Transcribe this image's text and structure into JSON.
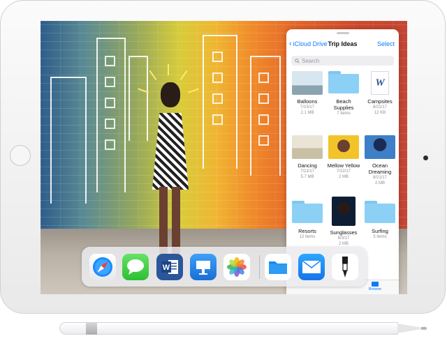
{
  "files_panel": {
    "back_label": "iCloud Drive",
    "title": "Trip Ideas",
    "select_label": "Select",
    "search_placeholder": "Search",
    "items": [
      {
        "name": "Balloons",
        "line2": "7/15/17",
        "line3": "2.1 MB",
        "kind": "photo"
      },
      {
        "name": "Beach Supplies",
        "line2": "7 items",
        "line3": "",
        "kind": "folder"
      },
      {
        "name": "Campsites",
        "line2": "8/21/17",
        "line3": "12 KB",
        "kind": "word-doc"
      },
      {
        "name": "Dancing",
        "line2": "7/22/17",
        "line3": "5.7 MB",
        "kind": "photo"
      },
      {
        "name": "Mellow Yellow",
        "line2": "7/22/17",
        "line3": "2 MB",
        "kind": "photo"
      },
      {
        "name": "Ocean Dreaming",
        "line2": "8/21/17",
        "line3": "2 MB",
        "kind": "photo"
      },
      {
        "name": "Resorts",
        "line2": "12 items",
        "line3": "",
        "kind": "folder"
      },
      {
        "name": "Sunglasses",
        "line2": "8/3/17",
        "line3": "2 MB",
        "kind": "photo"
      },
      {
        "name": "Surfing",
        "line2": "5 items",
        "line3": "",
        "kind": "folder"
      }
    ],
    "tab_browse_label": "Browse"
  },
  "dock": {
    "apps": [
      "safari-icon",
      "messages-icon",
      "word-icon",
      "keynote-icon",
      "photos-icon",
      "files-icon",
      "mail-icon",
      "sketch-pen-icon"
    ]
  },
  "colors": {
    "accent": "#0a7cf9",
    "folder": "#8cd0f5"
  }
}
